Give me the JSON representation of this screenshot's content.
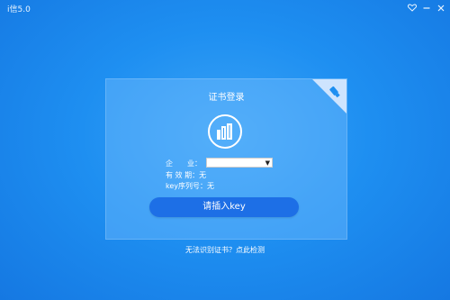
{
  "window": {
    "title": "i信5.0",
    "controls": {
      "heart_icon": "heart-icon",
      "minimize_icon": "minimize-icon",
      "close_icon": "close-icon"
    }
  },
  "card": {
    "title": "证书登录",
    "logo_icon": "building-icon",
    "usb_icon": "usb-key-icon",
    "fields": {
      "company_label": "企　　业：",
      "company_value": "",
      "valid_label": "有 效 期：",
      "valid_value": "无",
      "key_label": "key序列号：",
      "key_value": "无"
    },
    "button_label": "请插入key"
  },
  "footer": {
    "link": "无法识别证书？点此检测"
  },
  "colors": {
    "background": "#1e8ff1",
    "button": "#1d6fe6",
    "card": "#78beff"
  }
}
